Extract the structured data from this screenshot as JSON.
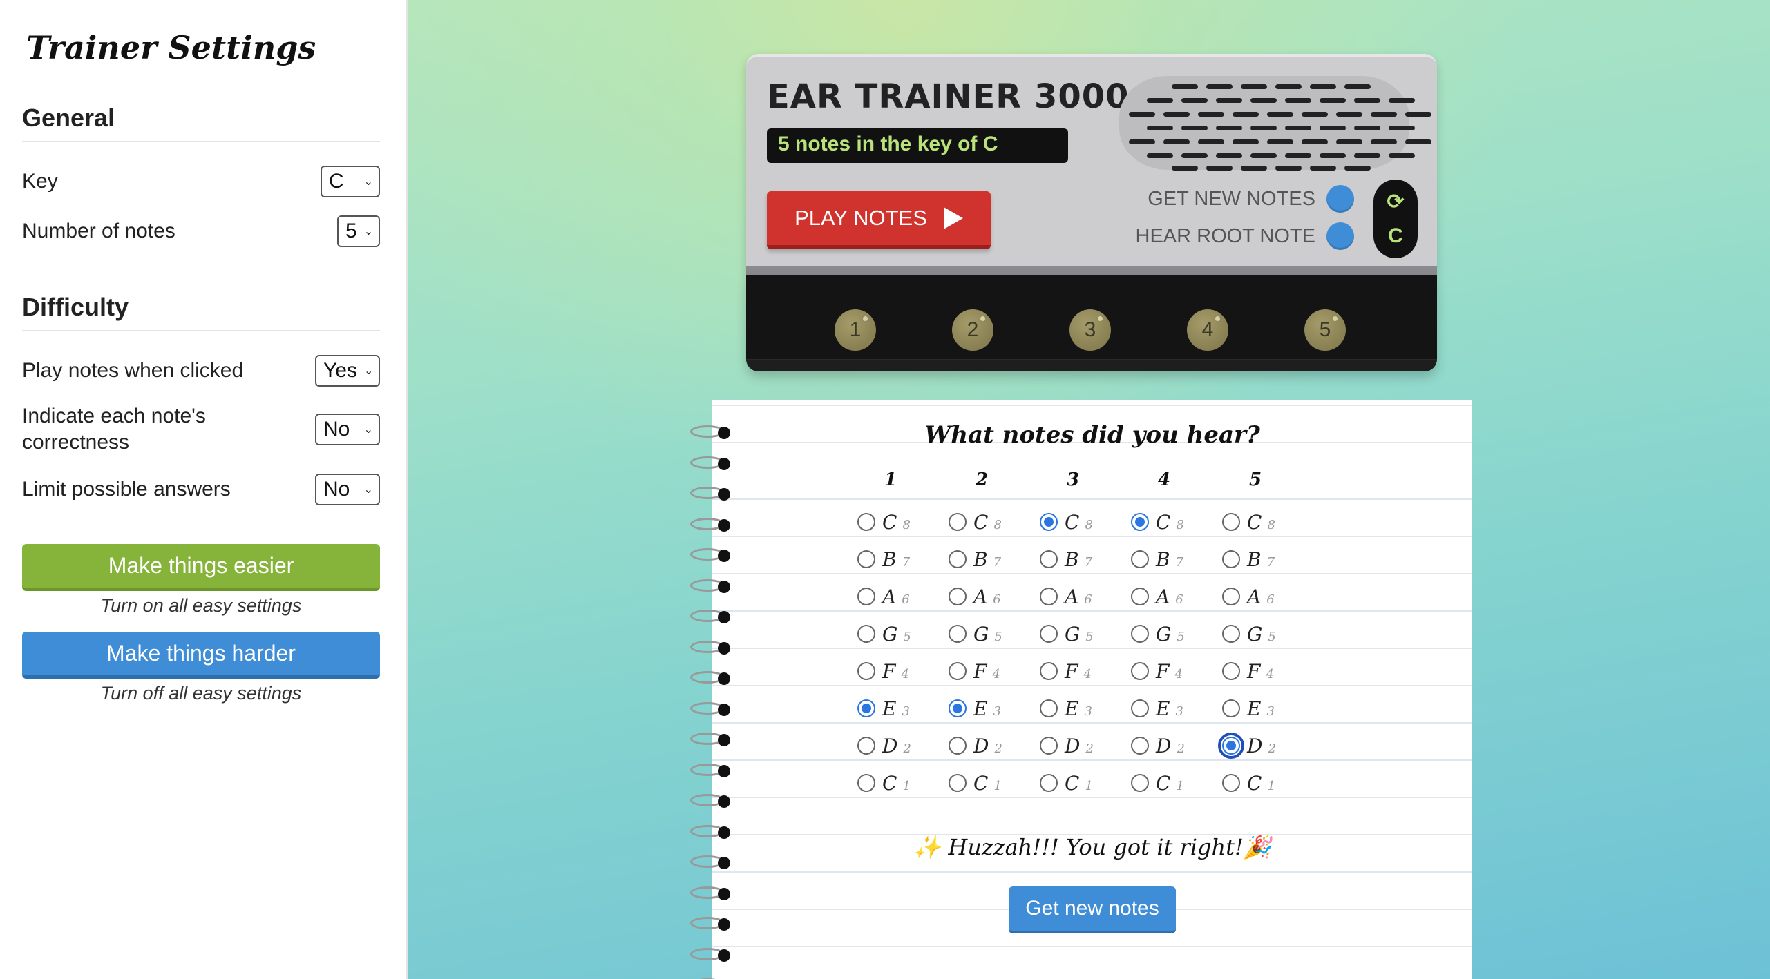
{
  "sidebar": {
    "title": "Trainer Settings",
    "general_heading": "General",
    "key_label": "Key",
    "key_value": "C",
    "num_notes_label": "Number of notes",
    "num_notes_value": "5",
    "difficulty_heading": "Difficulty",
    "play_clicked_label": "Play notes when clicked",
    "play_clicked_value": "Yes",
    "indicate_label": "Indicate each note's correctness",
    "indicate_value": "No",
    "limit_label": "Limit possible answers",
    "limit_value": "No",
    "easier_button": "Make things easier",
    "easier_note": "Turn on all easy settings",
    "harder_button": "Make things harder",
    "harder_note": "Turn off all easy settings"
  },
  "device": {
    "title": "EAR TRAINER 3000",
    "lcd_text": "5 notes in the key of C",
    "play_button": "PLAY NOTES",
    "get_new_notes": "GET NEW NOTES",
    "hear_root_note": "HEAR ROOT NOTE",
    "root_key": "C",
    "knobs": [
      "1",
      "2",
      "3",
      "4",
      "5"
    ]
  },
  "notebook": {
    "heading": "What notes did you hear?",
    "columns": [
      "1",
      "2",
      "3",
      "4",
      "5"
    ],
    "notes": [
      {
        "name": "C",
        "degree": "8"
      },
      {
        "name": "B",
        "degree": "7"
      },
      {
        "name": "A",
        "degree": "6"
      },
      {
        "name": "G",
        "degree": "5"
      },
      {
        "name": "F",
        "degree": "4"
      },
      {
        "name": "E",
        "degree": "3"
      },
      {
        "name": "D",
        "degree": "2"
      },
      {
        "name": "C",
        "degree": "1"
      }
    ],
    "selected": {
      "1": "E",
      "2": "E",
      "3": "C8",
      "4": "C8",
      "5": "D"
    },
    "feedback": "✨ Huzzah!!! You got it right!🎉",
    "get_new_button": "Get new notes"
  },
  "colors": {
    "accent_green": "#86b33a",
    "accent_blue": "#3f8dd6",
    "play_red": "#d0322d",
    "lcd_text": "#b9e27a"
  }
}
